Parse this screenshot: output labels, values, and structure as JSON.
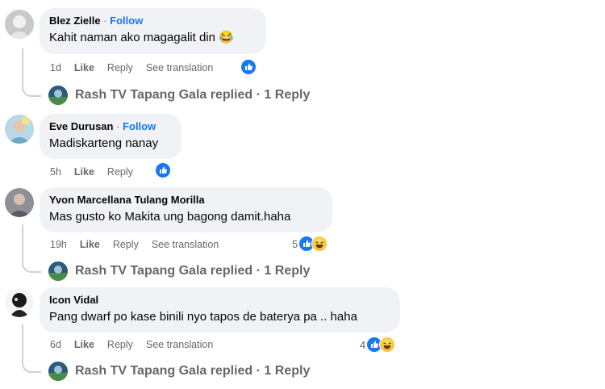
{
  "comments": [
    {
      "author": "Blez Zielle",
      "follow": "Follow",
      "text": "Kahit naman ako magagalit din 😂",
      "time": "1d",
      "like": "Like",
      "reply": "Reply",
      "translate": "See translation",
      "reaction_count": "",
      "reply_summary": "Rash TV Tapang Gala replied · 1 Reply"
    },
    {
      "author": "Eve Durusan",
      "follow": "Follow",
      "text": "Madiskarteng nanay",
      "time": "5h",
      "like": "Like",
      "reply": "Reply",
      "translate": "",
      "reaction_count": "",
      "reply_summary": ""
    },
    {
      "author": "Yvon Marcellana Tulang Morilla",
      "follow": "",
      "text": "Mas gusto ko Makita ung bagong damit.haha",
      "time": "19h",
      "like": "Like",
      "reply": "Reply",
      "translate": "See translation",
      "reaction_count": "5",
      "reply_summary": "Rash TV Tapang Gala replied · 1 Reply"
    },
    {
      "author": "Icon Vidal",
      "follow": "",
      "text": "Pang dwarf po kase binili nyo tapos de baterya pa .. haha",
      "time": "6d",
      "like": "Like",
      "reply": "Reply",
      "translate": "See translation",
      "reaction_count": "4",
      "reply_summary": "Rash TV Tapang Gala replied · 1 Reply"
    }
  ],
  "icons": {
    "like": "like-reaction-icon",
    "haha": "haha-reaction-icon"
  },
  "colors": {
    "bubble": "#f0f2f5",
    "link": "#1877f2",
    "muted": "#65676b"
  }
}
